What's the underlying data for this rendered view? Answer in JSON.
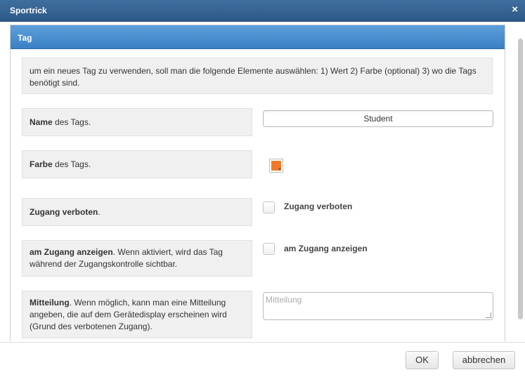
{
  "window": {
    "title": "Sportrick",
    "close_icon": "×"
  },
  "panel": {
    "title": "Tag"
  },
  "intro_text": "um ein neues Tag zu verwenden, soll man die folgende Elemente auswählen: 1) Wert 2) Farbe (optional) 3) wo die Tags benötigt sind.",
  "fields": {
    "name": {
      "label_bold": "Name",
      "label_rest": " des Tags.",
      "value": "Student"
    },
    "color": {
      "label_bold": "Farbe",
      "label_rest": " des Tags.",
      "swatch_color": "#f07a2a"
    },
    "access_denied": {
      "label_bold": "Zugang verboten",
      "label_rest": ".",
      "checkbox_label": "Zugang verboten",
      "checked": false
    },
    "show_at_access": {
      "label_bold": "am Zugang anzeigen",
      "label_rest": ". Wenn aktiviert, wird das Tag während der Zugangskontrolle sichtbar.",
      "checkbox_label": "am Zugang anzeigen",
      "checked": false
    },
    "message": {
      "label_bold": "Mitteilung",
      "label_rest": ". Wenn möglich, kann man eine Mitteilung angeben, die auf dem Gerätedisplay erscheinen wird (Grund des verbotenen Zugang).",
      "placeholder": "Mitteilung",
      "value": ""
    }
  },
  "buttons": {
    "ok": "OK",
    "cancel": "abbrechen"
  },
  "colors": {
    "titlebar": "#2d5987",
    "panel_header": "#3a80c4"
  }
}
